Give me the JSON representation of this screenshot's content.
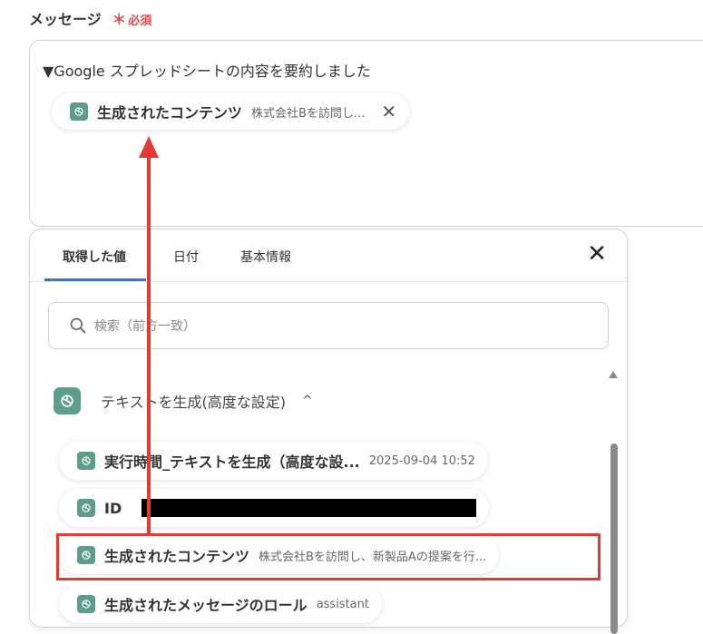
{
  "field": {
    "label": "メッセージ",
    "required_star": "＊",
    "required_text": "必須"
  },
  "message": {
    "text": "▼Google スプレッドシートの内容を要約しました",
    "chip": {
      "name": "生成されたコンテンツ",
      "value": "株式会社Bを訪問し...",
      "close": "✕"
    }
  },
  "popup": {
    "tabs": [
      {
        "label": "取得した値",
        "active": true
      },
      {
        "label": "日付"
      },
      {
        "label": "基本情報"
      }
    ],
    "close": "✕",
    "search_placeholder": "検索（前方一致）",
    "section": {
      "title": "テキストを生成(高度な設定)",
      "chevron": "^"
    },
    "items": [
      {
        "name": "実行時間_テキストを生成（高度な設...",
        "value": "2025-09-04 10:52"
      },
      {
        "name": "ID",
        "value": ""
      },
      {
        "name": "生成されたコンテンツ",
        "value": "株式会社Bを訪問し、新製品Aの提案を行..."
      },
      {
        "name": "生成されたメッセージのロール",
        "value": "assistant"
      }
    ]
  },
  "colors": {
    "accent_red": "#e53935",
    "tab_underline": "#2e7bbd",
    "gpt_icon": "#5c9d8b"
  }
}
